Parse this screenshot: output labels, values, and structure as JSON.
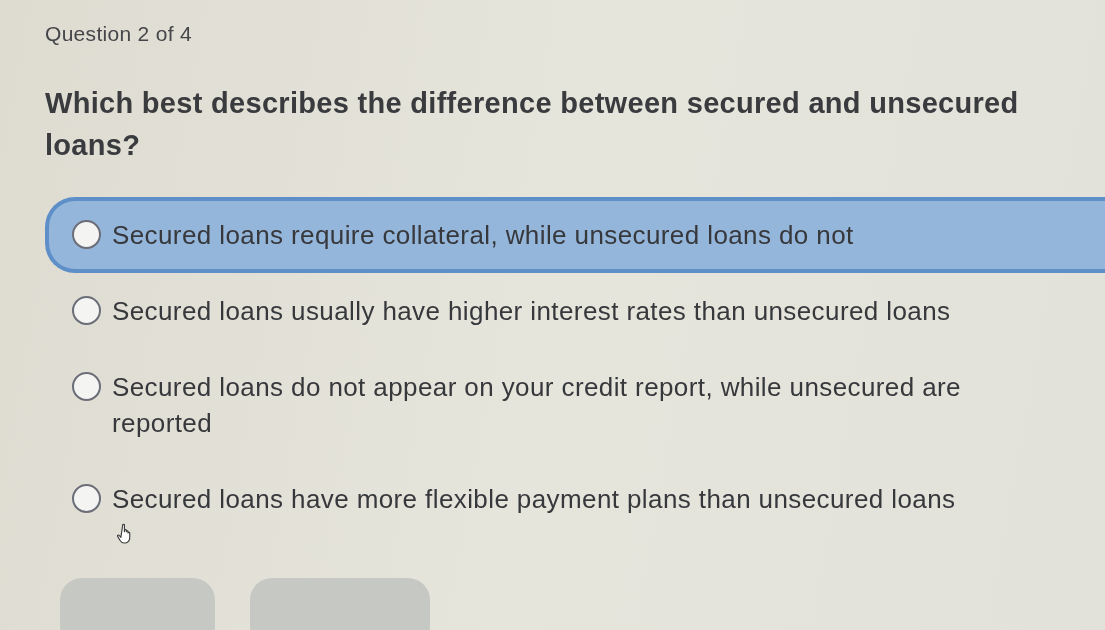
{
  "question_number": "Question 2 of 4",
  "question": "Which best describes the difference between secured and unsecured loans?",
  "options": [
    {
      "text": "Secured loans require collateral, while unsecured loans do not",
      "selected": true,
      "checked": false
    },
    {
      "text": "Secured loans usually have higher interest rates than unsecured loans",
      "selected": false,
      "checked": false
    },
    {
      "text": "Secured loans do not appear on your credit report, while unsecured are reported",
      "selected": false,
      "checked": false
    },
    {
      "text": "Secured loans have more flexible payment plans than unsecured loans",
      "selected": false,
      "checked": false
    }
  ],
  "pointer": {
    "kind": "hand"
  },
  "footer_buttons": [
    {
      "kind": "button"
    },
    {
      "kind": "button"
    }
  ]
}
